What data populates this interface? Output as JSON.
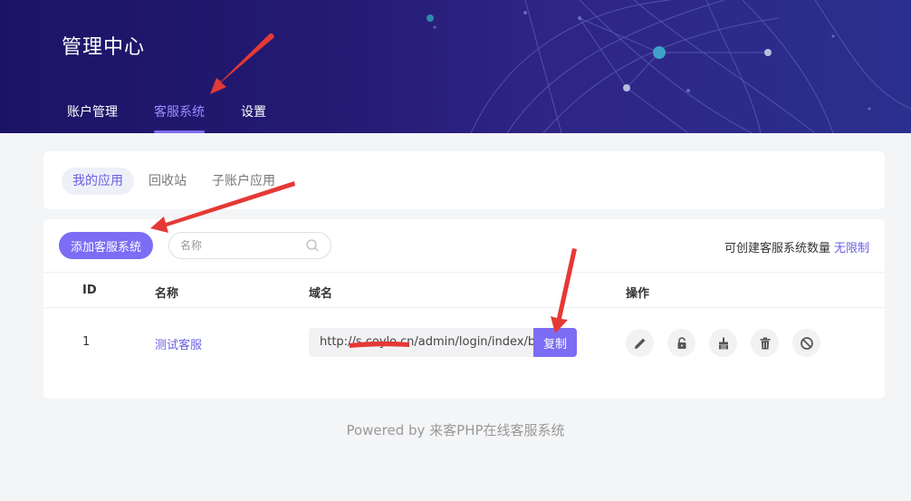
{
  "header": {
    "title": "管理中心",
    "nav": [
      {
        "label": "账户管理"
      },
      {
        "label": "客服系统",
        "active": true
      },
      {
        "label": "设置"
      }
    ]
  },
  "tabs": [
    {
      "label": "我的应用",
      "active": true
    },
    {
      "label": "回收站"
    },
    {
      "label": "子账户应用"
    }
  ],
  "toolbar": {
    "add_label": "添加客服系统",
    "search_placeholder": "名称",
    "quota_label": "可创建客服系统数量",
    "quota_value": "无限制"
  },
  "table": {
    "headers": [
      "ID",
      "名称",
      "域名",
      "操作"
    ],
    "rows": [
      {
        "id": "1",
        "name": "测试客服",
        "domain": "http://s.coylo.cn/admin/login/index/business",
        "copy_label": "复制",
        "actions": [
          "edit-icon",
          "unlock-icon",
          "broom-icon",
          "trash-icon",
          "ban-icon"
        ]
      }
    ]
  },
  "footer": {
    "text": "Powered by 来客PHP在线客服系统"
  },
  "colors": {
    "accent": "#7b6df4",
    "header_bg": "#1b1466",
    "annotation": "#e53935"
  }
}
